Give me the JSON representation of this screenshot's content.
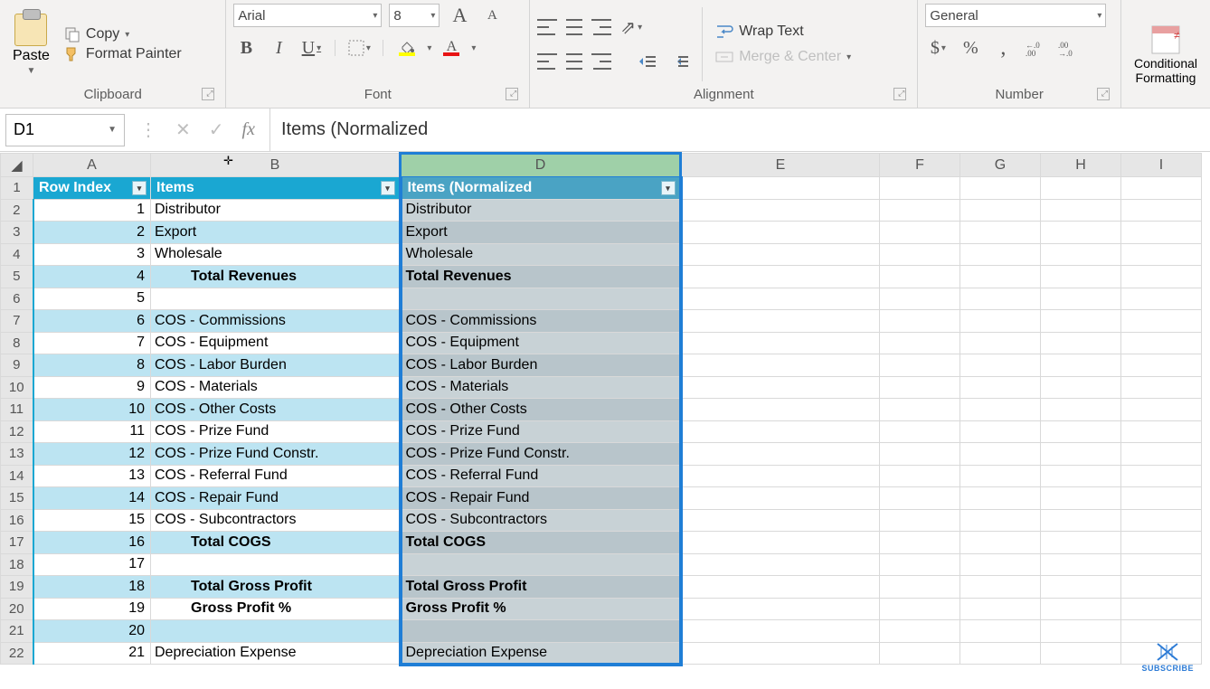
{
  "ribbon": {
    "clipboard": {
      "label": "Clipboard",
      "paste": "Paste",
      "copy": "Copy",
      "format_painter": "Format Painter"
    },
    "font": {
      "label": "Font",
      "name": "Arial",
      "size": "8",
      "bold": "B",
      "italic": "I",
      "underline": "U"
    },
    "alignment": {
      "label": "Alignment",
      "wrap": "Wrap Text",
      "merge": "Merge & Center"
    },
    "number": {
      "label": "Number",
      "format": "General",
      "currency": "$",
      "percent": "%",
      "comma": ",",
      "inc": ".00→.0",
      "dec": ".0→.00"
    },
    "cond": "Conditional Formatting"
  },
  "namebox": "D1",
  "formula": "Items (Normalized",
  "columns": [
    "A",
    "B",
    "D",
    "E",
    "F",
    "G",
    "H",
    "I"
  ],
  "headers": {
    "A": "Row Index",
    "B": "Items",
    "D": "Items (Normalized"
  },
  "rows": [
    {
      "n": 1,
      "a": "",
      "b": "",
      "d": "",
      "hdr": true
    },
    {
      "n": 2,
      "a": "1",
      "b": "Distributor",
      "d": "Distributor"
    },
    {
      "n": 3,
      "a": "2",
      "b": "Export",
      "d": "Export"
    },
    {
      "n": 4,
      "a": "3",
      "b": "Wholesale",
      "d": "Wholesale"
    },
    {
      "n": 5,
      "a": "4",
      "b": "Total Revenues",
      "d": "Total Revenues",
      "bold": true,
      "indent": true
    },
    {
      "n": 6,
      "a": "5",
      "b": "",
      "d": ""
    },
    {
      "n": 7,
      "a": "6",
      "b": "COS - Commissions",
      "d": "COS - Commissions"
    },
    {
      "n": 8,
      "a": "7",
      "b": "COS - Equipment",
      "d": "COS - Equipment"
    },
    {
      "n": 9,
      "a": "8",
      "b": "COS - Labor Burden",
      "d": "COS - Labor Burden"
    },
    {
      "n": 10,
      "a": "9",
      "b": "COS - Materials",
      "d": "COS - Materials"
    },
    {
      "n": 11,
      "a": "10",
      "b": "COS - Other Costs",
      "d": "COS - Other Costs"
    },
    {
      "n": 12,
      "a": "11",
      "b": "COS - Prize Fund",
      "d": "COS - Prize Fund"
    },
    {
      "n": 13,
      "a": "12",
      "b": "COS - Prize Fund Constr.",
      "d": "COS - Prize Fund Constr."
    },
    {
      "n": 14,
      "a": "13",
      "b": "COS - Referral Fund",
      "d": "COS - Referral Fund"
    },
    {
      "n": 15,
      "a": "14",
      "b": "COS - Repair Fund",
      "d": "COS - Repair Fund"
    },
    {
      "n": 16,
      "a": "15",
      "b": "COS - Subcontractors",
      "d": "COS - Subcontractors"
    },
    {
      "n": 17,
      "a": "16",
      "b": "Total COGS",
      "d": "Total COGS",
      "bold": true,
      "indent": true
    },
    {
      "n": 18,
      "a": "17",
      "b": "",
      "d": ""
    },
    {
      "n": 19,
      "a": "18",
      "b": "Total Gross Profit",
      "d": "Total Gross Profit",
      "bold": true,
      "indent": true
    },
    {
      "n": 20,
      "a": "19",
      "b": "Gross Profit %",
      "d": "Gross Profit %",
      "bold": true,
      "indent": true
    },
    {
      "n": 21,
      "a": "20",
      "b": "",
      "d": ""
    },
    {
      "n": 22,
      "a": "21",
      "b": "Depreciation Expense",
      "d": "Depreciation Expense"
    }
  ],
  "subscribe": "SUBSCRIBE"
}
